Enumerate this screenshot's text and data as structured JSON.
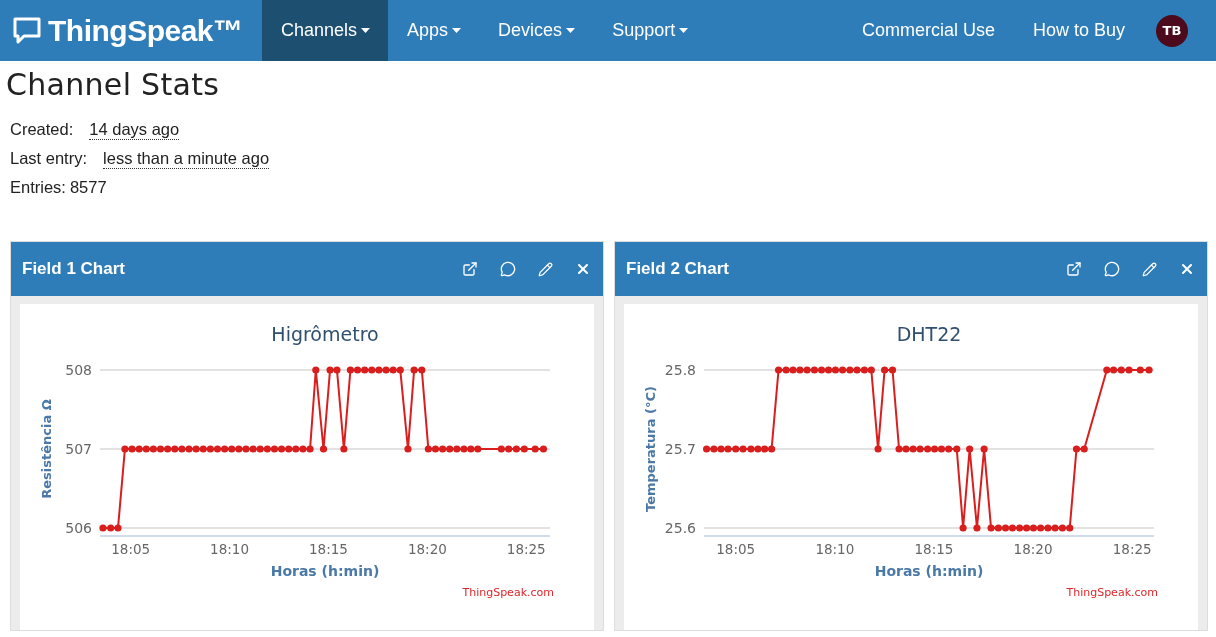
{
  "navbar": {
    "brand": "ThingSpeak™",
    "menus": [
      {
        "label": "Channels",
        "selected": true
      },
      {
        "label": "Apps",
        "selected": false
      },
      {
        "label": "Devices",
        "selected": false
      },
      {
        "label": "Support",
        "selected": false
      }
    ],
    "links": [
      "Commercial Use",
      "How to Buy"
    ],
    "avatar": "TB"
  },
  "page_title": "Channel Stats",
  "stats": [
    {
      "kind": "timeago",
      "label": "Created:",
      "value": "14 days ago"
    },
    {
      "kind": "timeago",
      "label": "Last entry:",
      "value": "less than a minute ago"
    },
    {
      "kind": "plain",
      "label": "Entries:",
      "value": "8577"
    }
  ],
  "panels": [
    {
      "title": "Field 1 Chart",
      "credit": "ThingSpeak.com",
      "chart_data": {
        "type": "line",
        "title": "Higrômetro",
        "xlabel": "Horas (h:min)",
        "ylabel": "Resistência Ω",
        "x": [
          1083.6,
          1083.99,
          1084.36,
          1084.71,
          1085.07,
          1085.43,
          1085.79,
          1086.15,
          1086.51,
          1086.87,
          1087.23,
          1087.59,
          1087.95,
          1088.31,
          1088.67,
          1089.03,
          1089.39,
          1089.75,
          1090.11,
          1090.47,
          1090.83,
          1091.19,
          1091.55,
          1091.91,
          1092.27,
          1092.63,
          1092.99,
          1093.35,
          1093.71,
          1094.07,
          1094.36,
          1094.75,
          1095.08,
          1095.43,
          1095.78,
          1096.11,
          1096.47,
          1096.83,
          1097.19,
          1097.55,
          1097.91,
          1098.27,
          1098.63,
          1099.02,
          1099.33,
          1099.72,
          1100.05,
          1100.41,
          1100.77,
          1101.13,
          1101.49,
          1101.85,
          1102.2,
          1102.55,
          1103.74,
          1104.11,
          1104.5,
          1104.9,
          1105.45,
          1105.87
        ],
        "series": [
          {
            "color": "#d91e1e",
            "marker": "circle",
            "values": [
              506,
              506,
              506,
              507,
              507,
              507,
              507,
              507,
              507,
              507,
              507,
              507,
              507,
              507,
              507,
              507,
              507,
              507,
              507,
              507,
              507,
              507,
              507,
              507,
              507,
              507,
              507,
              507,
              507,
              507,
              508,
              507,
              508,
              508,
              507,
              508,
              508,
              508,
              508,
              508,
              508,
              508,
              508,
              507,
              508,
              508,
              507,
              507,
              507,
              507,
              507,
              507,
              507,
              507,
              507,
              507,
              507,
              507,
              507,
              507
            ]
          }
        ],
        "xlim": [
          1083.45,
          1106.2
        ],
        "ylim": [
          506,
          508
        ],
        "xticks": [
          {
            "value": 1085,
            "label": "18:05"
          },
          {
            "value": 1090,
            "label": "18:10"
          },
          {
            "value": 1095,
            "label": "18:15"
          },
          {
            "value": 1100,
            "label": "18:20"
          },
          {
            "value": 1105,
            "label": "18:25"
          }
        ],
        "yticks": [
          506,
          507,
          508
        ]
      }
    },
    {
      "title": "Field 2 Chart",
      "credit": "ThingSpeak.com",
      "chart_data": {
        "type": "line",
        "title": "DHT22",
        "xlabel": "Horas (h:min)",
        "ylabel": "Temperatura (°C)",
        "x": [
          1083.53,
          1083.9,
          1084.26,
          1084.61,
          1085.0,
          1085.37,
          1085.77,
          1086.12,
          1086.46,
          1086.81,
          1087.16,
          1087.54,
          1087.89,
          1088.24,
          1088.6,
          1088.97,
          1089.33,
          1089.68,
          1090.03,
          1090.39,
          1090.76,
          1091.12,
          1091.49,
          1091.84,
          1092.18,
          1092.51,
          1092.91,
          1093.24,
          1093.59,
          1093.95,
          1094.3,
          1094.68,
          1095.03,
          1095.38,
          1095.74,
          1096.15,
          1096.47,
          1096.8,
          1097.17,
          1097.53,
          1097.88,
          1098.25,
          1098.61,
          1098.96,
          1099.32,
          1099.67,
          1100.02,
          1100.38,
          1100.75,
          1101.11,
          1101.48,
          1101.85,
          1102.19,
          1102.58,
          1103.72,
          1104.06,
          1104.45,
          1104.84,
          1105.41,
          1105.85
        ],
        "series": [
          {
            "color": "#d91e1e",
            "marker": "circle",
            "values": [
              25.7,
              25.7,
              25.7,
              25.7,
              25.7,
              25.7,
              25.7,
              25.7,
              25.7,
              25.7,
              25.8,
              25.8,
              25.8,
              25.8,
              25.8,
              25.8,
              25.8,
              25.8,
              25.8,
              25.8,
              25.8,
              25.8,
              25.8,
              25.8,
              25.7,
              25.8,
              25.8,
              25.7,
              25.7,
              25.7,
              25.7,
              25.7,
              25.7,
              25.7,
              25.7,
              25.7,
              25.6,
              25.7,
              25.6,
              25.7,
              25.6,
              25.6,
              25.6,
              25.6,
              25.6,
              25.6,
              25.6,
              25.6,
              25.6,
              25.6,
              25.6,
              25.6,
              25.7,
              25.7,
              25.8,
              25.8,
              25.8,
              25.8,
              25.8,
              25.8
            ]
          }
        ],
        "xlim": [
          1083.4,
          1106.1
        ],
        "ylim": [
          25.6,
          25.8
        ],
        "xticks": [
          {
            "value": 1085,
            "label": "18:05"
          },
          {
            "value": 1090,
            "label": "18:10"
          },
          {
            "value": 1095,
            "label": "18:15"
          },
          {
            "value": 1100,
            "label": "18:20"
          },
          {
            "value": 1105,
            "label": "18:25"
          }
        ],
        "yticks": [
          25.6,
          25.7,
          25.8
        ]
      }
    }
  ]
}
